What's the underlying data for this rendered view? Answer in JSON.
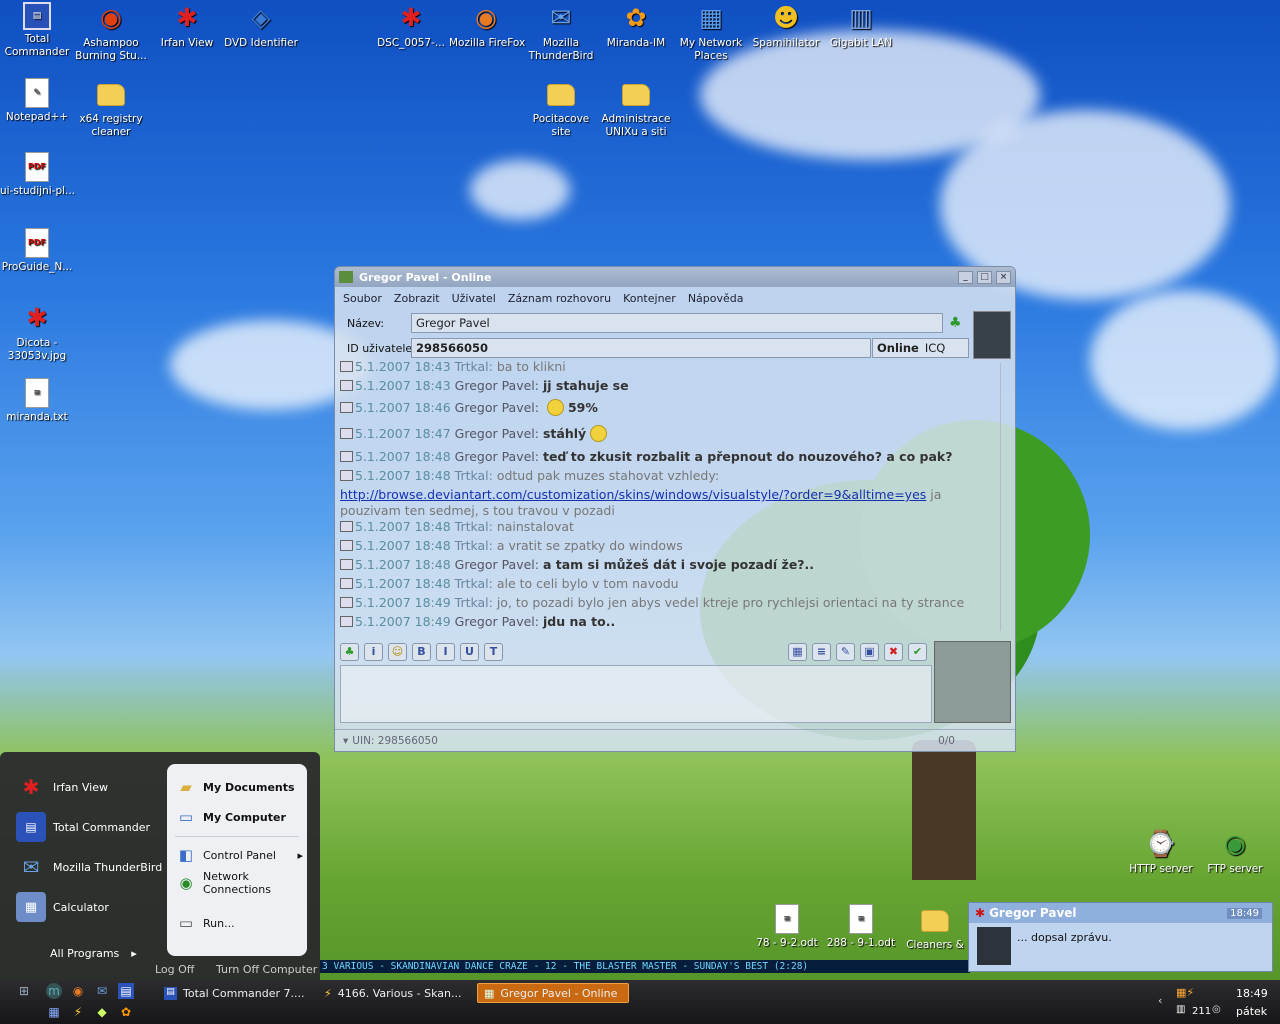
{
  "desktop_icons": [
    {
      "label": "Total\nCommander",
      "icon": "floppy-icon"
    },
    {
      "label": "Ashampoo\nBurning Stu...",
      "icon": "disc-icon"
    },
    {
      "label": "Irfan View",
      "icon": "irfanview-icon"
    },
    {
      "label": "DVD Identifier",
      "icon": "dvd-icon"
    },
    {
      "label": "DSC_0057-...",
      "icon": "irfanview-icon"
    },
    {
      "label": "Mozilla FireFox",
      "icon": "firefox-icon"
    },
    {
      "label": "Mozilla\nThunderBird",
      "icon": "thunderbird-icon"
    },
    {
      "label": "Miranda-IM",
      "icon": "miranda-icon"
    },
    {
      "label": "My Network\nPlaces",
      "icon": "network-icon"
    },
    {
      "label": "Spamihilator",
      "icon": "spamihilator-icon"
    },
    {
      "label": "Gigabit LAN",
      "icon": "lan-icon"
    },
    {
      "label": "Notepad++",
      "icon": "notepad-icon"
    },
    {
      "label": "x64 registry\ncleaner",
      "icon": "folder-icon"
    },
    {
      "label": "Pocitacove\nsite",
      "icon": "folder-icon"
    },
    {
      "label": "Administrace\nUNIXu a siti",
      "icon": "folder-icon"
    },
    {
      "label": "ui-studijni-pl...",
      "icon": "pdf-icon"
    },
    {
      "label": "ProGuide_N...",
      "icon": "pdf-icon"
    },
    {
      "label": "Dicota -\n33053v.jpg",
      "icon": "irfanview-icon"
    },
    {
      "label": "miranda.txt",
      "icon": "text-file-icon"
    },
    {
      "label": "HTTP server",
      "icon": "http-server-icon"
    },
    {
      "label": "FTP server",
      "icon": "ftp-server-icon"
    },
    {
      "label": "78 - 9-2.odt",
      "icon": "document-icon"
    },
    {
      "label": "288 - 9-1.odt",
      "icon": "document-icon"
    },
    {
      "label": "Cleaners &",
      "icon": "folder-icon"
    }
  ],
  "miranda": {
    "title": "Gregor Pavel - Online",
    "menu": [
      "Soubor",
      "Zobrazit",
      "Uživatel",
      "Záznam rozhovoru",
      "Kontejner",
      "Nápověda"
    ],
    "name_label": "Název:",
    "name_value": "Gregor Pavel",
    "id_label": "ID uživatele:",
    "id_value": "298566050",
    "status": "Online",
    "protocol": "ICQ",
    "messages": [
      {
        "ts": "5.1.2007 18:43",
        "who": "Trtkal:",
        "text": "ba to klikni",
        "bold": false
      },
      {
        "ts": "5.1.2007 18:43",
        "who": "Gregor Pavel:",
        "text": "jj stahuje se",
        "bold": true
      },
      {
        "ts": "5.1.2007 18:46",
        "who": "Gregor Pavel:",
        "text": "59%",
        "bold": true,
        "smiley": true
      },
      {
        "ts": "5.1.2007 18:47",
        "who": "Gregor Pavel:",
        "text": "stáhlý",
        "bold": true,
        "smiley_after": true
      },
      {
        "ts": "5.1.2007 18:48",
        "who": "Gregor Pavel:",
        "text": "teď to zkusit rozbalit a přepnout do nouzového? a co pak?",
        "bold": true
      },
      {
        "ts": "5.1.2007 18:48",
        "who": "Trtkal:",
        "text": "odtud pak muzes stahovat vzhledy:",
        "bold": false
      },
      {
        "ts": "5.1.2007 18:48",
        "who": "Trtkal:",
        "text": "nainstalovat",
        "bold": false
      },
      {
        "ts": "5.1.2007 18:48",
        "who": "Trtkal:",
        "text": "a vratit se zpatky do windows",
        "bold": false
      },
      {
        "ts": "5.1.2007 18:48",
        "who": "Gregor Pavel:",
        "text": "a tam si můžeš dát i svoje pozadí že?..",
        "bold": true
      },
      {
        "ts": "5.1.2007 18:48",
        "who": "Trtkal:",
        "text": "ale to celi bylo v tom navodu",
        "bold": false
      },
      {
        "ts": "5.1.2007 18:49",
        "who": "Trtkal:",
        "text": "jo, to pozadi bylo jen abys vedel ktreje pro rychlejsi orientaci na ty strance",
        "bold": false
      },
      {
        "ts": "5.1.2007 18:49",
        "who": "Gregor Pavel:",
        "text": "jdu na to..",
        "bold": true
      }
    ],
    "link": "http://browse.deviantart.com/customization/skins/windows/visualstyle/?order=9&alltime=yes",
    "link_after": " ja",
    "link_line2": "pouzivam ten sedmej, s tou travou v pozadi",
    "uin": "UIN: 298566050",
    "counter": "0/0"
  },
  "startmenu": {
    "pinned": [
      "Irfan View",
      "Total Commander",
      "Mozilla ThunderBird",
      "Calculator"
    ],
    "all_programs": "All Programs",
    "right": [
      "My Documents",
      "My Computer",
      "Control Panel",
      "Network\nConnections",
      "Run..."
    ],
    "logoff": "Log Off",
    "turnoff": "Turn Off Computer"
  },
  "taskbar": {
    "tasks": [
      "Total Commander 7....",
      "4166. Various - Skan...",
      "Gregor Pavel - Online"
    ],
    "time": "18:49",
    "day": "pátek",
    "tray_num": "211"
  },
  "popup": {
    "title": "Gregor Pavel",
    "message": "... dopsal zprávu.",
    "clock": "18:49"
  },
  "nowplaying": "3  VARIOUS - SKANDINAVIAN DANCE CRAZE - 12 - THE BLASTER MASTER - SUNDAY'S BEST (2:28)",
  "colors": {
    "accent": "#3a6cc8",
    "online": "#2a8a2a"
  }
}
